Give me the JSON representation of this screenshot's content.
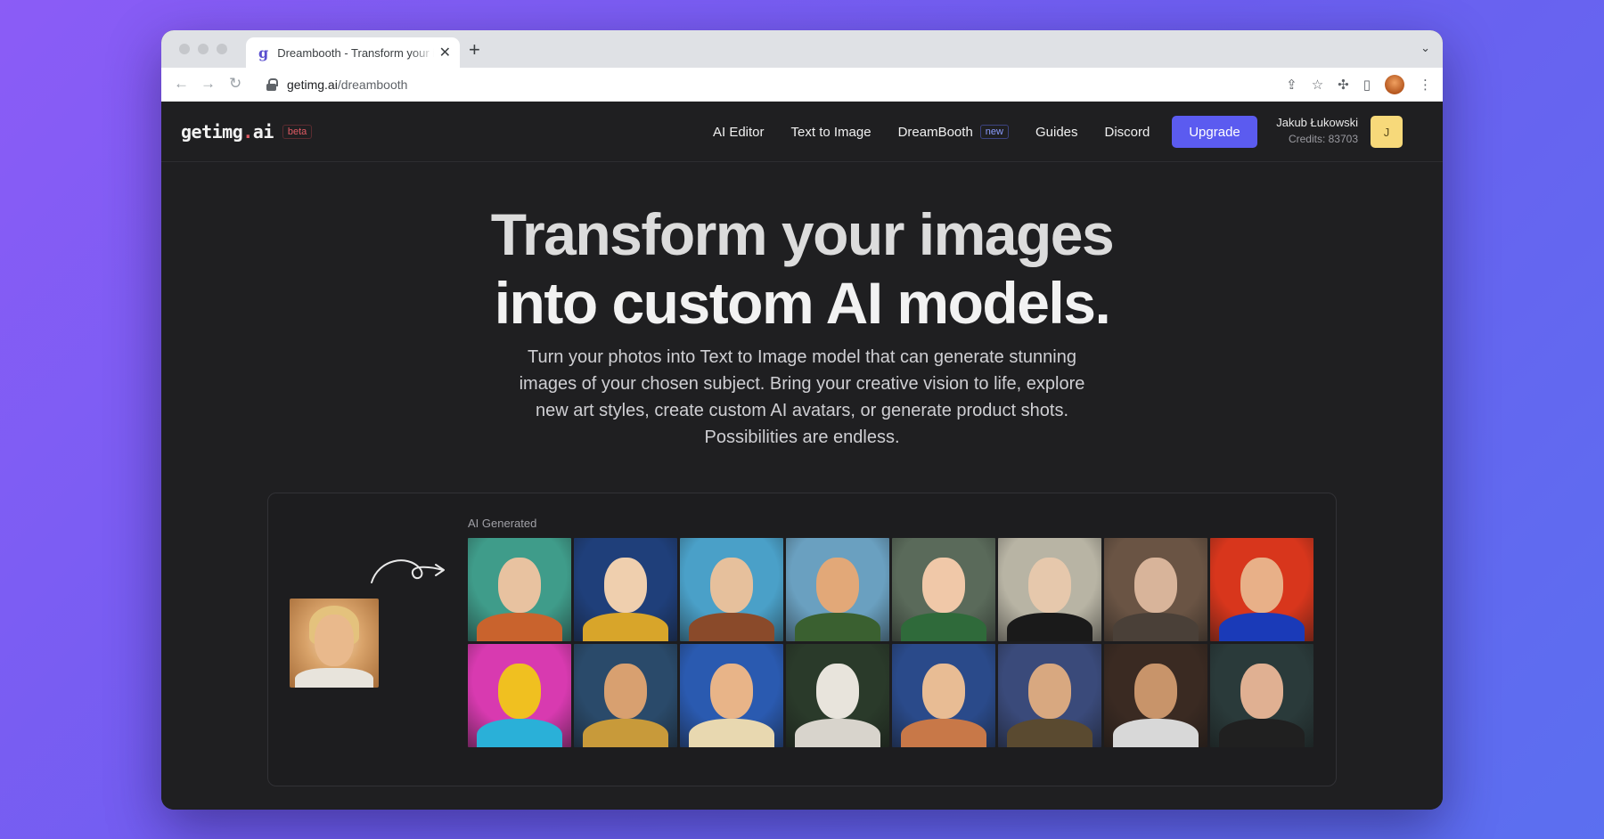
{
  "browser": {
    "tab_title": "Dreambooth - Transform your images",
    "tab_favicon": "g",
    "url_host": "getimg.ai",
    "url_path": "/dreambooth"
  },
  "header": {
    "logo_main": "getimg",
    "logo_dot": ".",
    "logo_tld": "ai",
    "beta_badge": "beta",
    "nav": {
      "ai_editor": "AI Editor",
      "text_to_image": "Text to Image",
      "dreambooth": "DreamBooth",
      "dreambooth_badge": "new",
      "guides": "Guides",
      "discord": "Discord"
    },
    "upgrade_label": "Upgrade",
    "user_name": "Jakub Łukowski",
    "credits": "Credits: 83703",
    "avatar_initial": "J"
  },
  "hero": {
    "headline_line1": "Transform your images",
    "headline_line2": "into custom AI models.",
    "subtitle": "Turn your photos into Text to Image model that can generate stunning images of your chosen subject. Bring your creative vision to life, explore new art styles, create custom AI avatars, or generate product shots. Possibilities are endless."
  },
  "showcase": {
    "generated_label": "AI Generated",
    "tiles": [
      {
        "bg": "#3f9c8a",
        "skin": "#e8c2a0",
        "body": "#c9632d"
      },
      {
        "bg": "#1f3f7a",
        "skin": "#efcfae",
        "body": "#d8a52a"
      },
      {
        "bg": "#4aa0c8",
        "skin": "#e6c09c",
        "body": "#8a4a2a"
      },
      {
        "bg": "#6aa0c0",
        "skin": "#e2a878",
        "body": "#3a6030"
      },
      {
        "bg": "#5a6a5a",
        "skin": "#f0c8a8",
        "body": "#2f6a3a"
      },
      {
        "bg": "#b8b4a4",
        "skin": "#e6c8ac",
        "body": "#1a1a1a"
      },
      {
        "bg": "#6a5444",
        "skin": "#d8b49a",
        "body": "#4a4038"
      },
      {
        "bg": "#d8361c",
        "skin": "#e8b088",
        "body": "#1a3ab8"
      },
      {
        "bg": "#d83ab0",
        "skin": "#f0c020",
        "body": "#2ab0d8"
      },
      {
        "bg": "#2a4a6a",
        "skin": "#d8a070",
        "body": "#c89a3a"
      },
      {
        "bg": "#2a5ab0",
        "skin": "#e8b488",
        "body": "#e8d8b0"
      },
      {
        "bg": "#2a3a2a",
        "skin": "#e8e4dc",
        "body": "#d8d4cc"
      },
      {
        "bg": "#2a4a8a",
        "skin": "#e8bc94",
        "body": "#c87848"
      },
      {
        "bg": "#3a4a7a",
        "skin": "#d8a880",
        "body": "#5a4a30"
      },
      {
        "bg": "#3a2a22",
        "skin": "#c8946a",
        "body": "#d8d8d8"
      },
      {
        "bg": "#2a3a3a",
        "skin": "#e0b092",
        "body": "#202020"
      }
    ]
  }
}
